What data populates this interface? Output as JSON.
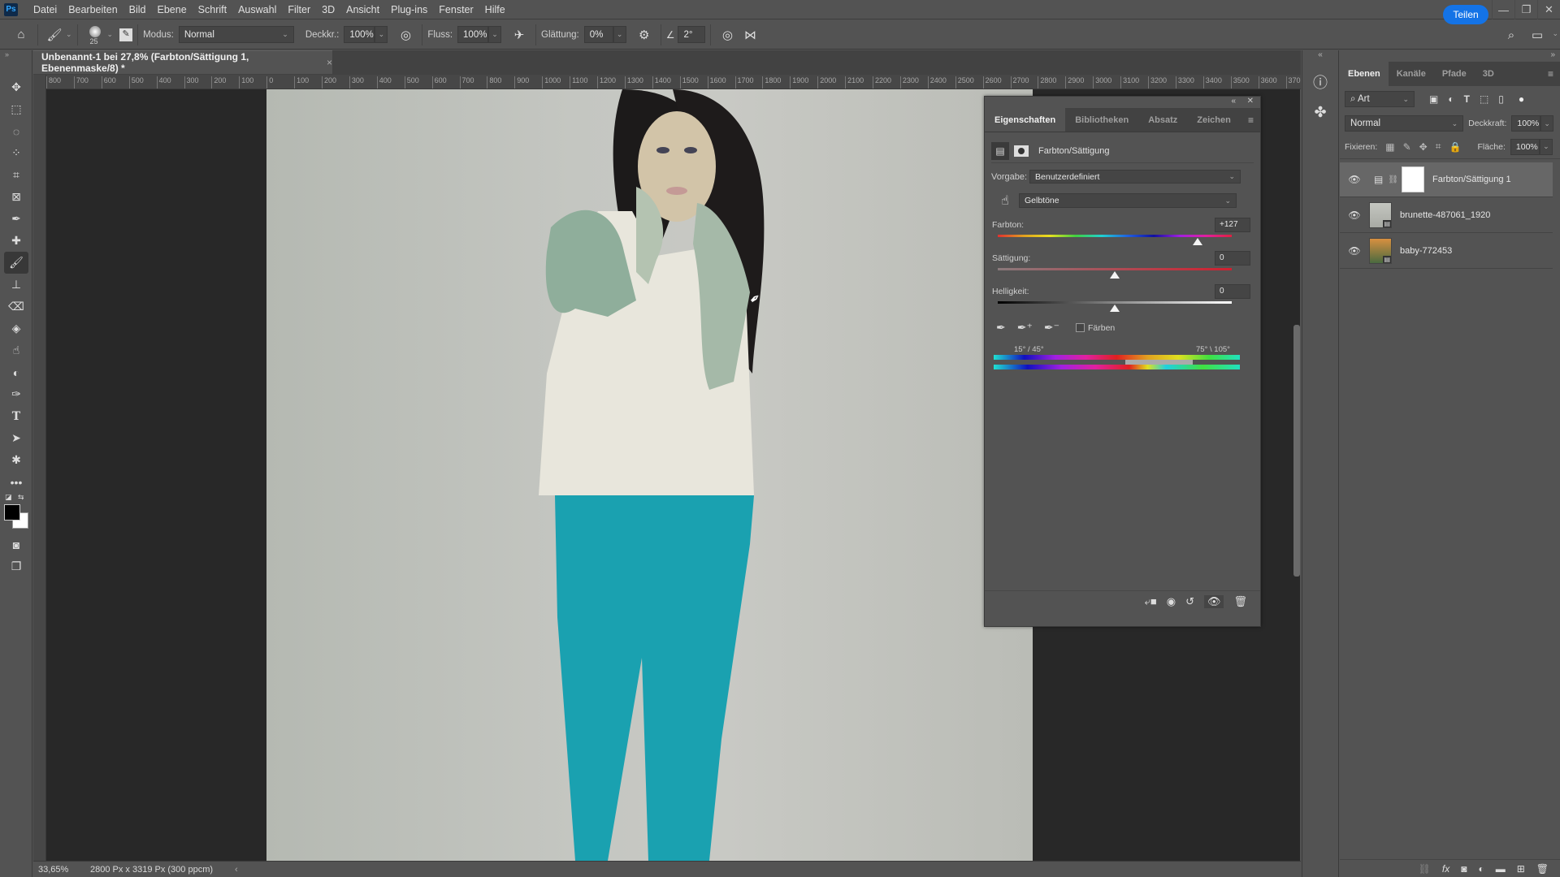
{
  "app": {
    "logo": "Ps"
  },
  "menu": [
    "Datei",
    "Bearbeiten",
    "Bild",
    "Ebene",
    "Schrift",
    "Auswahl",
    "Filter",
    "3D",
    "Ansicht",
    "Plug-ins",
    "Fenster",
    "Hilfe"
  ],
  "window_controls": {
    "minimize": "—",
    "restore": "❐",
    "close": "✕"
  },
  "options": {
    "brush_size": "25",
    "mode_label": "Modus:",
    "mode_value": "Normal",
    "opacity_label": "Deckkr.:",
    "opacity_value": "100%",
    "flow_label": "Fluss:",
    "flow_value": "100%",
    "smoothing_label": "Glättung:",
    "smoothing_value": "0%",
    "angle_value": "2°",
    "share_label": "Teilen"
  },
  "document": {
    "tab_title": "Unbenannt-1 bei 27,8% (Farbton/Sättigung 1, Ebenenmaske/8) *",
    "ruler_ticks": [
      "800",
      "700",
      "600",
      "500",
      "400",
      "300",
      "200",
      "100",
      "0",
      "100",
      "200",
      "300",
      "400",
      "500",
      "600",
      "700",
      "800",
      "900",
      "1000",
      "1100",
      "1200",
      "1300",
      "1400",
      "1500",
      "1600",
      "1700",
      "1800",
      "1900",
      "2000",
      "2100",
      "2200",
      "2300",
      "2400",
      "2500",
      "2600",
      "2700",
      "2800",
      "2900",
      "3000",
      "3100",
      "3200",
      "3300",
      "3400",
      "3500",
      "3600",
      "370"
    ]
  },
  "status": {
    "zoom": "33,65%",
    "doc_info": "2800 Px x 3319 Px (300 ppcm)"
  },
  "properties": {
    "tabs": [
      "Eigenschaften",
      "Bibliotheken",
      "Absatz",
      "Zeichen"
    ],
    "active_tab": 0,
    "adjustment_title": "Farbton/Sättigung",
    "preset_label": "Vorgabe:",
    "preset_value": "Benutzerdefiniert",
    "channel_value": "Gelbtöne",
    "hue_label": "Farbton:",
    "hue_value": "+127",
    "hue_fraction": 0.853,
    "saturation_label": "Sättigung:",
    "saturation_value": "0",
    "saturation_fraction": 0.5,
    "lightness_label": "Helligkeit:",
    "lightness_value": "0",
    "lightness_fraction": 0.5,
    "colorize_label": "Färben",
    "colorize_checked": false,
    "range_left": "15° / 45°",
    "range_right": "75° \\ 105°"
  },
  "layers_panel": {
    "tabs": [
      "Ebenen",
      "Kanäle",
      "Pfade",
      "3D"
    ],
    "filter_value": "Art",
    "blend_mode": "Normal",
    "opacity_label": "Deckkraft:",
    "opacity_value": "100%",
    "lock_label": "Fixieren:",
    "fill_label": "Fläche:",
    "fill_value": "100%",
    "layers": [
      {
        "name": "Farbton/Sättigung 1",
        "type": "adjustment",
        "visible": true,
        "selected": true
      },
      {
        "name": "brunette-487061_1920",
        "type": "smart-object",
        "visible": true,
        "selected": false
      },
      {
        "name": "baby-772453",
        "type": "smart-object",
        "visible": true,
        "selected": false
      }
    ]
  }
}
